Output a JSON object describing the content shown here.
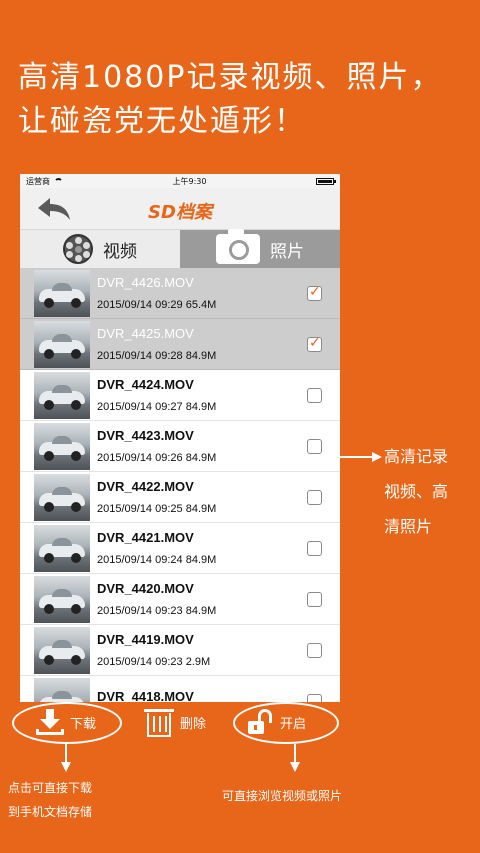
{
  "headline": {
    "line1": "高清1080P记录视频、照片，",
    "line2": "让碰瓷党无处遁形！"
  },
  "status_bar": {
    "carrier": "运营商",
    "time": "上午9:30"
  },
  "nav": {
    "title": "SD档案"
  },
  "tabs": [
    {
      "label": "视频",
      "icon": "film-reel-icon",
      "active": true
    },
    {
      "label": "照片",
      "icon": "camera-icon",
      "active": false
    }
  ],
  "files": [
    {
      "name": "DVR_4426.MOV",
      "datetime": "2015/09/14 09:29",
      "size": "65.4M",
      "selected": true
    },
    {
      "name": "DVR_4425.MOV",
      "datetime": "2015/09/14 09:28",
      "size": "84.9M",
      "selected": true
    },
    {
      "name": "DVR_4424.MOV",
      "datetime": "2015/09/14 09:27",
      "size": "84.9M",
      "selected": false
    },
    {
      "name": "DVR_4423.MOV",
      "datetime": "2015/09/14 09:26",
      "size": "84.9M",
      "selected": false
    },
    {
      "name": "DVR_4422.MOV",
      "datetime": "2015/09/14 09:25",
      "size": "84.9M",
      "selected": false
    },
    {
      "name": "DVR_4421.MOV",
      "datetime": "2015/09/14 09:24",
      "size": "84.9M",
      "selected": false
    },
    {
      "name": "DVR_4420.MOV",
      "datetime": "2015/09/14 09:23",
      "size": "84.9M",
      "selected": false
    },
    {
      "name": "DVR_4419.MOV",
      "datetime": "2015/09/14 09:23",
      "size": "2.9M",
      "selected": false
    },
    {
      "name": "DVR_4418.MOV",
      "datetime": "",
      "size": "",
      "selected": false
    }
  ],
  "toolbar": {
    "download_label": "下载",
    "delete_label": "删除",
    "open_label": "开启"
  },
  "annotations": {
    "side_line1": "高清记录",
    "side_line2": "视频、高",
    "side_line3": "清照片",
    "download_line1": "点击可直接下载",
    "download_line2": "到手机文档存储",
    "open_caption": "可直接浏览视频或照片"
  },
  "colors": {
    "brand_orange": "#e8661a",
    "tab_inactive": "#9b9b9b",
    "row_selected": "#cdcdcd"
  }
}
